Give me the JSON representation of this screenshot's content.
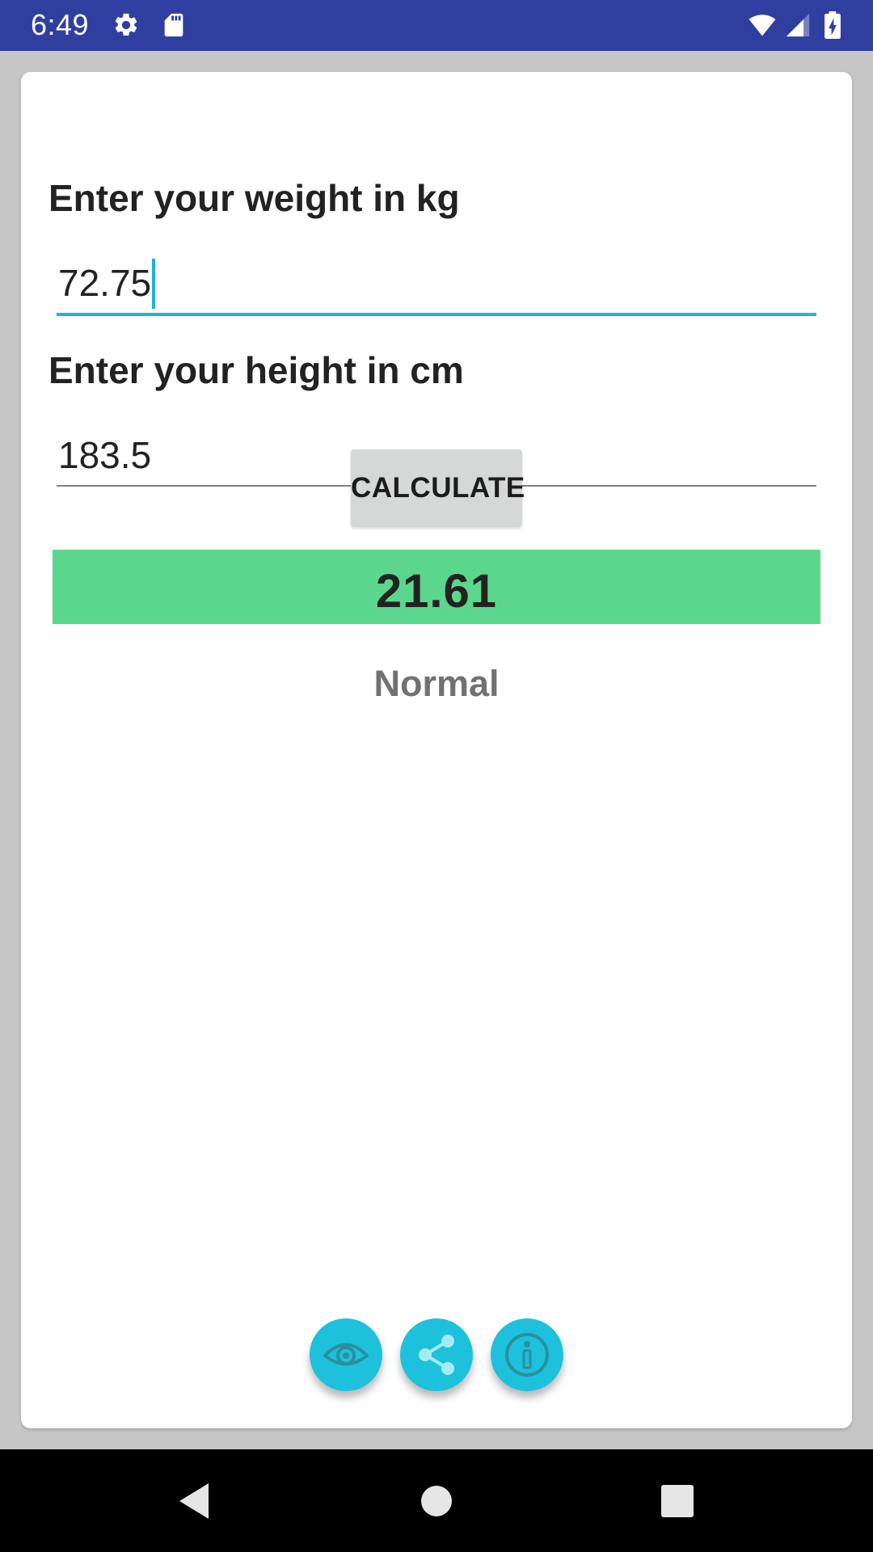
{
  "status_bar": {
    "time": "6:49",
    "left_icons": [
      "settings-icon",
      "sd-card-icon"
    ],
    "right_icons": [
      "wifi-icon",
      "cell-signal-icon",
      "battery-charging-icon"
    ],
    "background_color": "#303f9f"
  },
  "form": {
    "weight_label": "Enter your weight in kg",
    "weight_value": "72.75",
    "height_label": "Enter your height in cm",
    "height_value": "183.5",
    "calculate_label": "CALCULATE"
  },
  "result": {
    "bmi_value": "21.61",
    "category": "Normal",
    "highlight_color": "#5bd78d"
  },
  "actions": {
    "buttons": [
      "eye-icon",
      "share-icon",
      "info-icon"
    ],
    "accent_color": "#1ec1dc"
  },
  "nav_bar": {
    "buttons": [
      "back-icon",
      "home-icon",
      "recents-icon"
    ]
  }
}
